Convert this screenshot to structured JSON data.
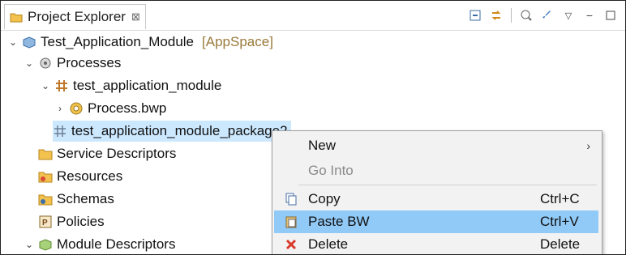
{
  "view": {
    "title": "Project Explorer",
    "close_glyph": "⊠"
  },
  "tree": {
    "root": {
      "label": "Test_Application_Module",
      "tag": "[AppSpace]"
    },
    "processes": "Processes",
    "pkg": "test_application_module",
    "process_file": "Process.bwp",
    "pkg2": "test_application_module_package2",
    "service_descriptors": "Service Descriptors",
    "resources": "Resources",
    "schemas": "Schemas",
    "policies": "Policies",
    "module_descriptors": "Module Descriptors"
  },
  "menu": {
    "new": "New",
    "go_into": "Go Into",
    "copy": {
      "label": "Copy",
      "accel": "Ctrl+C"
    },
    "paste": {
      "label": "Paste BW",
      "accel": "Ctrl+V"
    },
    "delete": {
      "label": "Delete",
      "accel": "Delete"
    }
  },
  "colors": {
    "selection": "#cce8ff",
    "menu_hot": "#91c9f7",
    "menu_bg": "#f2f2f2",
    "appspace_tag": "#9a7a3a"
  }
}
